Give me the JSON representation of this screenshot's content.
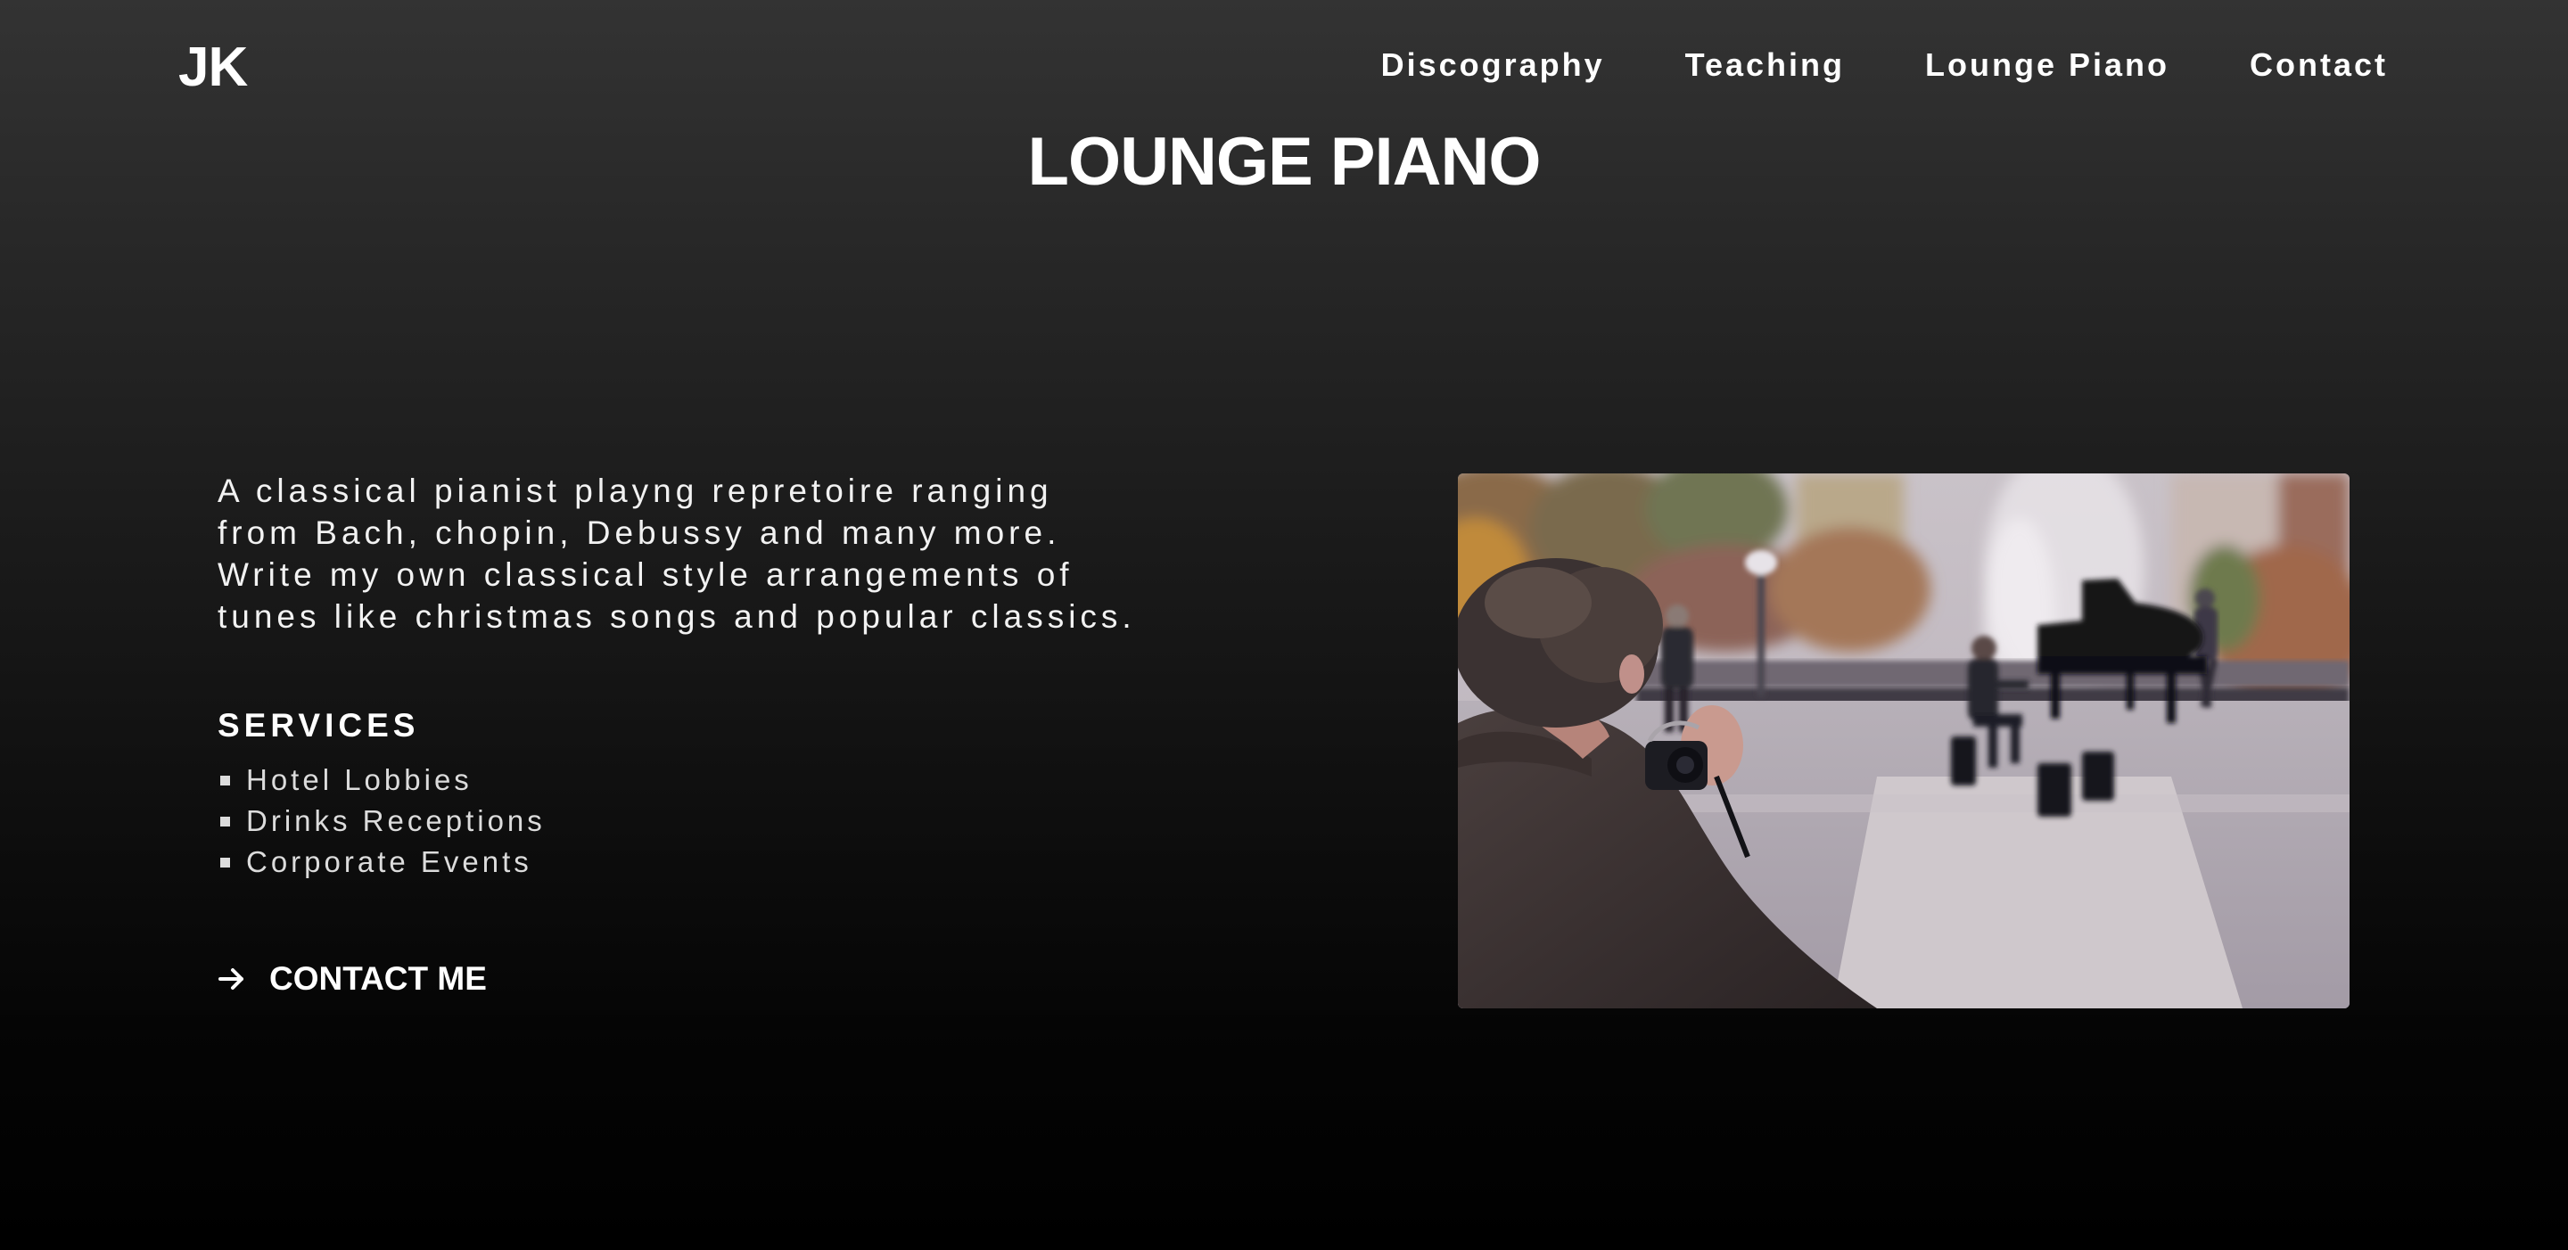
{
  "header": {
    "logo": "JK",
    "nav": [
      {
        "label": "Discography"
      },
      {
        "label": "Teaching"
      },
      {
        "label": "Lounge Piano"
      },
      {
        "label": "Contact"
      }
    ]
  },
  "main": {
    "title": "LOUNGE PIANO",
    "intro": "A classical pianist playng repretoire ranging from Bach, chopin, Debussy and many more. Write my own classical style arrangements of tunes like christmas songs and popular classics.",
    "services_heading": "SERVICES",
    "services": [
      "Hotel Lobbies",
      "Drinks Receptions",
      "Corporate Events"
    ],
    "cta_label": "CONTACT ME",
    "cta_icon": "arrow-right-icon",
    "image_subject": "photographer-photographing-pianist-in-park"
  },
  "colors": {
    "background_top": "#333333",
    "background_bottom": "#000000",
    "text": "#ffffff"
  }
}
